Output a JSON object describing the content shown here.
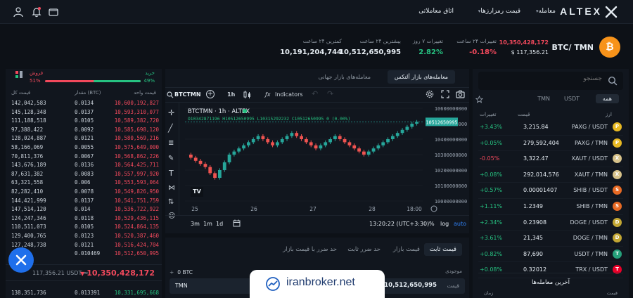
{
  "nav": {
    "brand": "ALTEX",
    "items": [
      {
        "label": "معامله",
        "caret": true
      },
      {
        "label": "قیمت رمزارزها",
        "caret": true
      },
      {
        "label": "اتاق معاملاتی",
        "caret": false
      }
    ]
  },
  "summary": {
    "coin_letter": "₿",
    "pair": "BTC/ TMN",
    "price_tmn": "10,350,428,172",
    "price_usd": "$ 117,356.21",
    "stats": [
      {
        "label": "تغییرات ۲۴ ساعت",
        "value": "-0.18%",
        "color": "#f2495c"
      },
      {
        "label": "تغییرات ۷ روز",
        "value": "2.82%",
        "color": "#26c281"
      },
      {
        "label": "بیشترین ۲۴ ساعت",
        "value": "10,512,650,995",
        "color": "#e6edf3"
      },
      {
        "label": "کمترین ۲۴ ساعت",
        "value": "10,191,204,744",
        "color": "#e6edf3"
      }
    ]
  },
  "markets": {
    "search_placeholder": "جستجو",
    "tabs": [
      "همه",
      "USDT",
      "TMN"
    ],
    "col_pair": "ارز",
    "col_price": "قیمت",
    "col_change": "تغییرات",
    "rows": [
      {
        "pair": "PAXG / USDT",
        "price": "3,215.84",
        "change": "+3.43%",
        "up": true,
        "icon_color": "#e8b923",
        "icon": "P"
      },
      {
        "pair": "PAXG / TMN",
        "price": "279,592,404",
        "change": "+0.05%",
        "up": true,
        "icon_color": "#e8b923",
        "icon": "P"
      },
      {
        "pair": "XAUT / USDT",
        "price": "3,322.47",
        "change": "-0.05%",
        "up": false,
        "icon_color": "#d7c28a",
        "icon": "X"
      },
      {
        "pair": "XAUT / TMN",
        "price": "292,014,576",
        "change": "+0.08%",
        "up": true,
        "icon_color": "#d7c28a",
        "icon": "X"
      },
      {
        "pair": "SHIB / USDT",
        "price": "0.00001407",
        "change": "+0.57%",
        "up": true,
        "icon_color": "#e86a24",
        "icon": "S"
      },
      {
        "pair": "SHIB / TMN",
        "price": "1.2349",
        "change": "+1.11%",
        "up": true,
        "icon_color": "#e86a24",
        "icon": "S"
      },
      {
        "pair": "DOGE / USDT",
        "price": "0.23908",
        "change": "+2.34%",
        "up": true,
        "icon_color": "#c2a633",
        "icon": "D"
      },
      {
        "pair": "DOGE / TMN",
        "price": "21,345",
        "change": "+3.61%",
        "up": true,
        "icon_color": "#c2a633",
        "icon": "D"
      },
      {
        "pair": "USDT / TMN",
        "price": "87,690",
        "change": "+0.82%",
        "up": true,
        "icon_color": "#26a17b",
        "icon": "T"
      },
      {
        "pair": "TRX / USDT",
        "price": "0.32012",
        "change": "+0.08%",
        "up": true,
        "icon_color": "#eb0029",
        "icon": "T"
      }
    ],
    "recent_title": "آخرین معامله‌ها",
    "recent_cols": [
      "قیمت",
      "زمان"
    ]
  },
  "orderbook": {
    "buy_label": "خرید",
    "buy_pct": "49%",
    "sell_label": "فروش",
    "sell_pct": "51%",
    "buy_fraction": 0.49,
    "col_price": "قیمت واحد",
    "col_amount": "مقدار (BTC)",
    "col_total": "قیمت کل",
    "rows": [
      {
        "price": "10,600,192,827",
        "amount": "0.0134",
        "total": "142,042,583"
      },
      {
        "price": "10,593,310,077",
        "amount": "0.0137",
        "total": "145,128,348"
      },
      {
        "price": "10,589,382,720",
        "amount": "0.0105",
        "total": "111,188,518"
      },
      {
        "price": "10,585,698,120",
        "amount": "0.0092",
        "total": "97,388,422"
      },
      {
        "price": "10,580,569,216",
        "amount": "0.0121",
        "total": "128,024,887"
      },
      {
        "price": "10,575,649,000",
        "amount": "0.0055",
        "total": "58,166,069"
      },
      {
        "price": "10,568,862,226",
        "amount": "0.0067",
        "total": "70,811,376"
      },
      {
        "price": "10,564,425,711",
        "amount": "0.0136",
        "total": "143,676,189"
      },
      {
        "price": "10,557,997,920",
        "amount": "0.0083",
        "total": "87,631,382"
      },
      {
        "price": "10,553,593,064",
        "amount": "0.006",
        "total": "63,321,558"
      },
      {
        "price": "10,549,826,950",
        "amount": "0.0078",
        "total": "82,282,410"
      },
      {
        "price": "10,541,751,759",
        "amount": "0.0137",
        "total": "144,421,999"
      },
      {
        "price": "10,536,722,922",
        "amount": "0.014",
        "total": "147,514,120"
      },
      {
        "price": "10,529,436,115",
        "amount": "0.0118",
        "total": "124,247,346"
      },
      {
        "price": "10,524,864,135",
        "amount": "0.0105",
        "total": "110,511,073"
      },
      {
        "price": "10,520,387,460",
        "amount": "0.0123",
        "total": "129,400,765"
      },
      {
        "price": "10,516,424,704",
        "amount": "0.0121",
        "total": "127,248,738"
      },
      {
        "price": "10,512,650,995",
        "amount": "0.010469",
        "total": "943"
      }
    ],
    "mid_usd": "117,356.21 USDT ≈",
    "mid_price": "10,350,428,172",
    "bottom_row": {
      "price": "10,331,695,668",
      "amount": "0.013391",
      "total": "138,351,736"
    }
  },
  "chart": {
    "tabs": [
      "معامله‌های بازار جهانی",
      "معامله‌های بازار آلتکس"
    ],
    "symbol": "BTCTMN",
    "interval": "1h",
    "indicators_label": "Indicators",
    "title": "BTCTMN · 1h · ALTEX",
    "ohlc": "O10342871196 H10512650995 L10315292232 C10512650995 0 (0.00%)",
    "last_price": "10512650995",
    "y_ticks": [
      "10600000000",
      "10500000000",
      "10400000000",
      "10300000000",
      "10200000000",
      "10100000000",
      "10000000000"
    ],
    "x_ticks": [
      "25",
      "26",
      "27",
      "28",
      "18:00"
    ],
    "ranges": [
      "3m",
      "1m",
      "1d"
    ],
    "clock": "13:20:22 (UTC+3:30)",
    "pct": "%",
    "log": "log",
    "auto": "auto",
    "tv_logo": "TV"
  },
  "chart_data": {
    "type": "candlestick",
    "title": "BTCTMN · 1h · ALTEX",
    "ylim": [
      10000000000,
      10600000000
    ],
    "x": [
      "25",
      "26",
      "27",
      "28",
      "18:00"
    ],
    "opens": [
      10300,
      10280,
      10260,
      10240,
      10220,
      10180,
      10150,
      10200,
      10250,
      10300,
      10320,
      10340,
      10360,
      10380,
      10400,
      10420,
      10400,
      10380,
      10360,
      10380,
      10400,
      10420,
      10440,
      10420,
      10400,
      10380,
      10360,
      10340,
      10360,
      10380,
      10400,
      10420,
      10400,
      10380,
      10360,
      10340,
      10320,
      10300,
      10320,
      10340,
      10360,
      10380,
      10400,
      10420,
      10440,
      10460,
      10480,
      10500
    ],
    "closes": [
      10280,
      10260,
      10240,
      10220,
      10180,
      10150,
      10200,
      10250,
      10300,
      10320,
      10340,
      10360,
      10380,
      10400,
      10420,
      10400,
      10380,
      10360,
      10380,
      10400,
      10420,
      10440,
      10420,
      10400,
      10380,
      10360,
      10340,
      10360,
      10380,
      10400,
      10420,
      10400,
      10380,
      10360,
      10340,
      10320,
      10300,
      10320,
      10340,
      10360,
      10380,
      10400,
      10420,
      10440,
      10460,
      10480,
      10500,
      10512
    ]
  },
  "orderform": {
    "tabs": [
      "قیمت ثابت",
      "قیمت بازار",
      "حد ضرر ثابت",
      "حد ضرر با قیمت بازار"
    ],
    "balance_label": "موجودی",
    "balance_btc": "0",
    "btc_unit": "BTC",
    "price_label": "قیمت",
    "price_value": "10,512,650,995",
    "unit_tmn": "TMN"
  },
  "watermark": "iranbroker.net"
}
